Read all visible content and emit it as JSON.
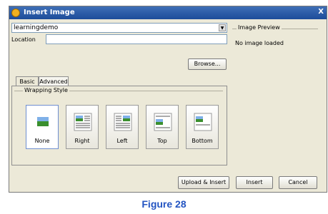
{
  "window": {
    "title": "Insert Image"
  },
  "image_select": {
    "value": "learningdemo"
  },
  "location": {
    "label": "Location",
    "value": ""
  },
  "browse_label": "Browse...",
  "tabs": [
    {
      "label": "Basic",
      "selected": true
    },
    {
      "label": "Advanced",
      "selected": false
    }
  ],
  "wrapping": {
    "title": "Wrapping Style",
    "options": [
      {
        "label": "None",
        "selected": true
      },
      {
        "label": "Right",
        "selected": false
      },
      {
        "label": "Left",
        "selected": false
      },
      {
        "label": "Top",
        "selected": false
      },
      {
        "label": "Bottom",
        "selected": false
      }
    ]
  },
  "preview": {
    "title": "Image Preview",
    "text": "No image loaded"
  },
  "buttons": {
    "upload_insert": "Upload & Insert",
    "insert": "Insert",
    "cancel": "Cancel"
  },
  "caption": "Figure 28",
  "colors": {
    "accent": "#2455c2",
    "titlebar": "#2a5aa8",
    "dialog_bg": "#ece9d8"
  }
}
